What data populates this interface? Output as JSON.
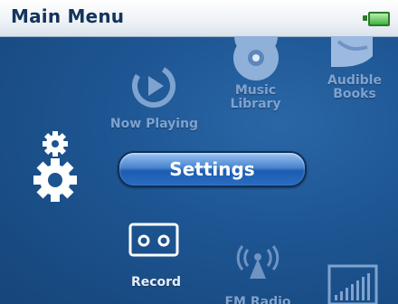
{
  "header": {
    "title": "Main Menu",
    "icons": {
      "battery": "battery-icon"
    }
  },
  "menu": {
    "now_playing": {
      "label": "Now Playing",
      "icon": "play-icon"
    },
    "music_library": {
      "label_line1": "Music",
      "label_line2": "Library",
      "icon": "disc-icon"
    },
    "audible_books": {
      "label_line1": "Audible",
      "label_line2": "Books",
      "icon": "book-icon"
    },
    "settings": {
      "label": "Settings",
      "icon": "gear-icon"
    },
    "record": {
      "label": "Record",
      "icon": "cassette-icon"
    },
    "fm_radio": {
      "label": "FM Radio",
      "icon": "radio-tower-icon"
    },
    "equalizer": {
      "icon": "equalizer-icon"
    }
  },
  "colors": {
    "background": "#1d5592",
    "title_bar": "#eef2f6",
    "selected_button": "#2a6cc2",
    "battery": "#3fb33f"
  }
}
